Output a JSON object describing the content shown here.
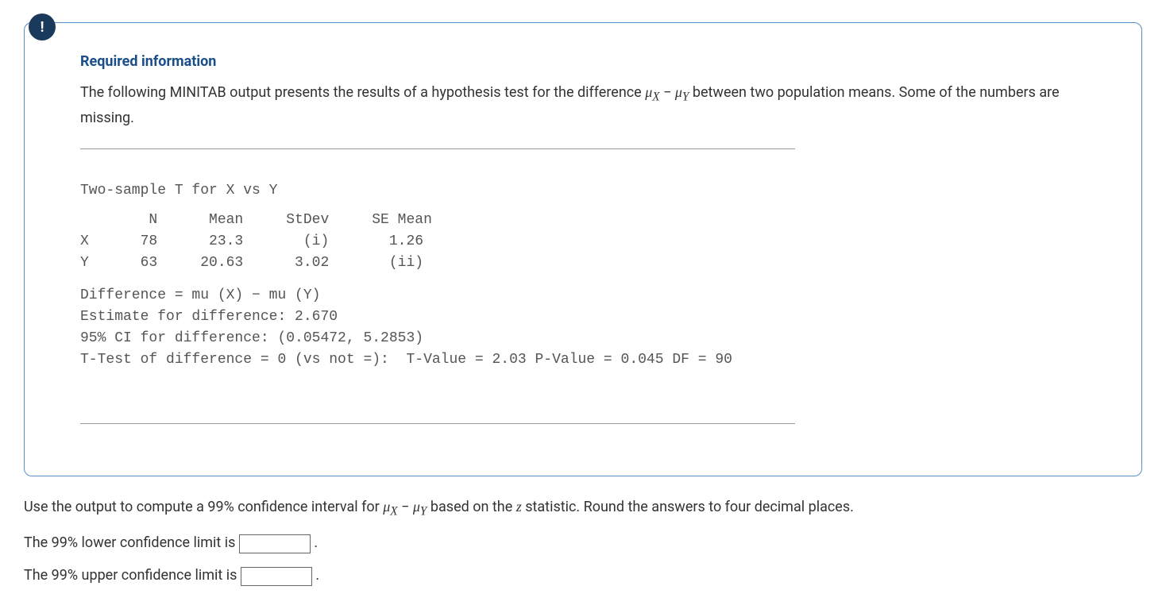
{
  "info_icon_label": "!",
  "required_heading": "Required information",
  "intro_part1": "The following MINITAB output presents the results of a hypothesis test for the difference ",
  "intro_part2": " between two population means. Some of the numbers are missing.",
  "minitab": {
    "title": "Two-sample T for X vs Y",
    "table_header": "        N      Mean     StDev     SE Mean",
    "table_row_x": "X      78      23.3       (i)       1.26",
    "table_row_y": "Y      63     20.63      3.02       (ii)",
    "line1": "Difference = mu (X) − mu (Y)",
    "line2": "Estimate for difference: 2.670",
    "line3": "95% CI for difference: (0.05472, 5.2853)",
    "line4": "T-Test of difference = 0 (vs not =):  T-Value = 2.03 P-Value = 0.045 DF = 90"
  },
  "question": {
    "prompt_part1": "Use the output to compute a 99% confidence interval for ",
    "prompt_part2": " based on the ",
    "z_label": "z",
    "prompt_part3": " statistic. Round the answers to four decimal places.",
    "lower_label": "The 99% lower confidence limit is ",
    "upper_label": "The 99% upper confidence limit is ",
    "period": " ."
  },
  "math": {
    "mu": "μ",
    "sub_x": "X",
    "minus": " − ",
    "sub_y": "Y"
  }
}
